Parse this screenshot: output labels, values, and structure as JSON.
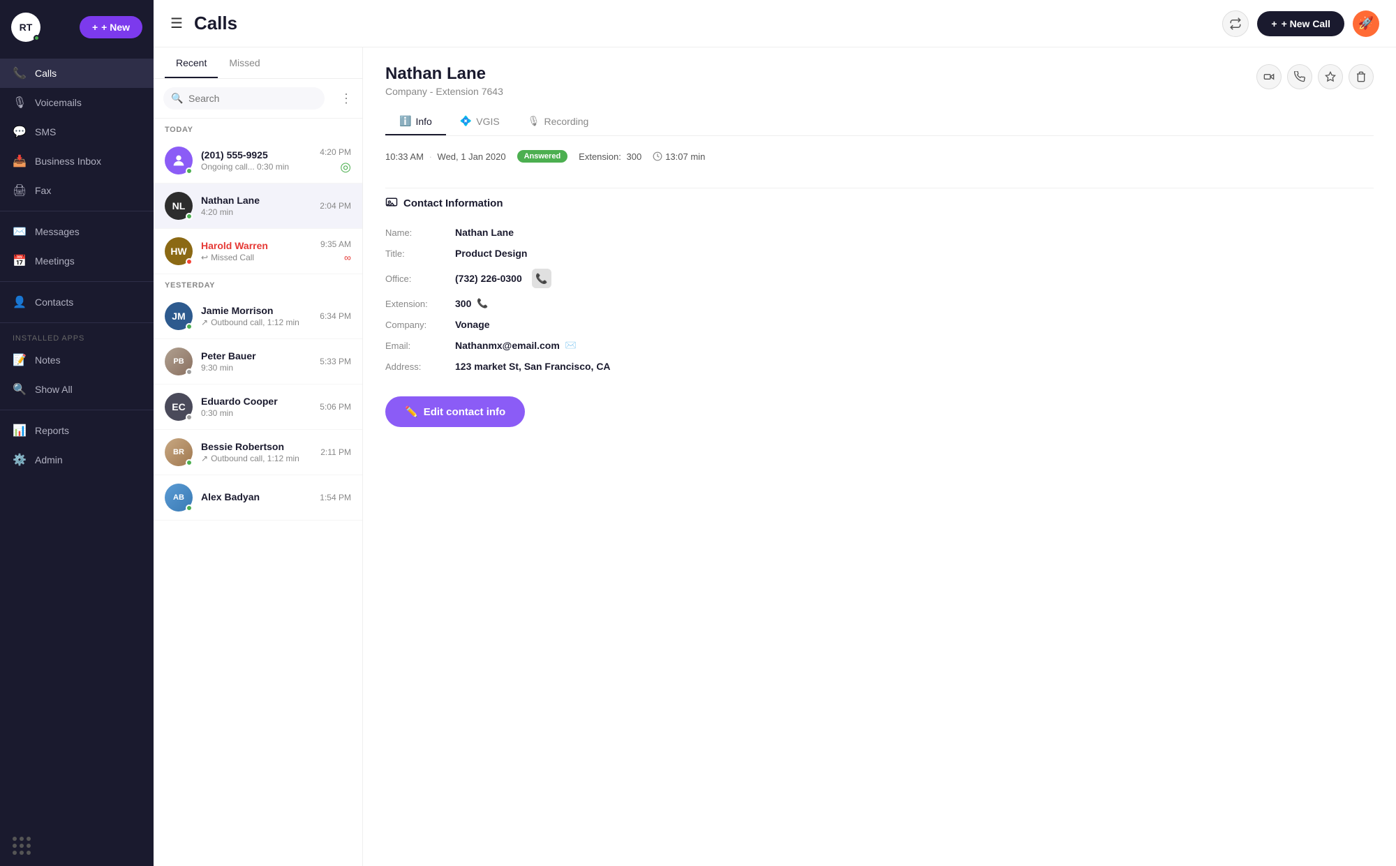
{
  "sidebar": {
    "avatar": "RT",
    "new_button": "+ New",
    "nav_items": [
      {
        "id": "calls",
        "label": "Calls",
        "icon": "📞",
        "active": true
      },
      {
        "id": "voicemails",
        "label": "Voicemails",
        "icon": "🎙️",
        "active": false
      },
      {
        "id": "sms",
        "label": "SMS",
        "icon": "💬",
        "active": false
      },
      {
        "id": "business-inbox",
        "label": "Business Inbox",
        "icon": "📥",
        "active": false
      },
      {
        "id": "fax",
        "label": "Fax",
        "icon": "🖨️",
        "active": false
      },
      {
        "id": "messages",
        "label": "Messages",
        "icon": "✉️",
        "active": false
      },
      {
        "id": "meetings",
        "label": "Meetings",
        "icon": "📅",
        "active": false
      },
      {
        "id": "contacts",
        "label": "Contacts",
        "icon": "👤",
        "active": false
      }
    ],
    "installed_apps_label": "INSTALLED APPS",
    "app_items": [
      {
        "id": "notes",
        "label": "Notes",
        "icon": "📝"
      },
      {
        "id": "show-all",
        "label": "Show All",
        "icon": "🔍"
      }
    ],
    "bottom_items": [
      {
        "id": "reports",
        "label": "Reports",
        "icon": "📊"
      },
      {
        "id": "admin",
        "label": "Admin",
        "icon": "⚙️"
      }
    ]
  },
  "topbar": {
    "page_title": "Calls",
    "new_call_label": "+ New Call"
  },
  "calls_panel": {
    "tabs": [
      {
        "id": "recent",
        "label": "Recent",
        "active": true
      },
      {
        "id": "missed",
        "label": "Missed",
        "active": false
      }
    ],
    "search_placeholder": "Search",
    "today_label": "TODAY",
    "yesterday_label": "YESTERDAY",
    "calls": [
      {
        "id": "call-1",
        "name": "(201) 555-9925",
        "sub": "Ongoing call... 0:30 min",
        "time": "4:20 PM",
        "initials": "?",
        "bg": "#8b5cf6",
        "color": "#fff",
        "status": "green",
        "is_live": true,
        "missed": false,
        "is_photo": false,
        "arrow": ""
      },
      {
        "id": "call-2",
        "name": "Nathan Lane",
        "sub": "4:20 min",
        "time": "2:04 PM",
        "initials": "NL",
        "bg": "#2d2d2d",
        "color": "#fff",
        "status": "green",
        "is_live": false,
        "missed": false,
        "active": true,
        "is_photo": false,
        "arrow": ""
      },
      {
        "id": "call-3",
        "name": "Harold Warren",
        "sub": "Missed Call",
        "time": "9:35 AM",
        "initials": "HW",
        "bg": "#8b4513",
        "color": "#fff",
        "status": "red",
        "is_live": false,
        "missed": true,
        "is_photo": false,
        "arrow": "↩"
      },
      {
        "id": "call-4",
        "name": "Jamie Morrison",
        "sub": "Outbound call, 1:12 min",
        "time": "6:34 PM",
        "initials": "JM",
        "bg": "#2d5a8e",
        "color": "#fff",
        "status": "green",
        "is_live": false,
        "missed": false,
        "is_photo": false,
        "arrow": "↗"
      },
      {
        "id": "call-5",
        "name": "Peter Bauer",
        "sub": "9:30 min",
        "time": "5:33 PM",
        "initials": "PB",
        "bg": "#ccc",
        "color": "#555",
        "status": "gray",
        "is_live": false,
        "missed": false,
        "is_photo": true,
        "photo_bg": "#b0a090",
        "arrow": ""
      },
      {
        "id": "call-6",
        "name": "Eduardo Cooper",
        "sub": "0:30 min",
        "time": "5:06 PM",
        "initials": "EC",
        "bg": "#444",
        "color": "#fff",
        "status": "gray",
        "is_live": false,
        "missed": false,
        "is_photo": false,
        "arrow": ""
      },
      {
        "id": "call-7",
        "name": "Bessie Robertson",
        "sub": "Outbound call, 1:12 min",
        "time": "2:11 PM",
        "initials": "BR",
        "bg": "#c8a882",
        "color": "#fff",
        "status": "green",
        "is_live": false,
        "missed": false,
        "is_photo": true,
        "photo_bg": "#c8a882",
        "arrow": "↗"
      },
      {
        "id": "call-8",
        "name": "Alex Badyan",
        "sub": "",
        "time": "1:54 PM",
        "initials": "AB",
        "bg": "#1abc9c",
        "color": "#fff",
        "status": "green",
        "is_live": false,
        "missed": false,
        "is_photo": true,
        "photo_bg": "#5a9bd4",
        "arrow": ""
      }
    ]
  },
  "detail": {
    "name": "Nathan Lane",
    "subtitle": "Company  -  Extension 7643",
    "tabs": [
      {
        "id": "info",
        "label": "Info",
        "icon": "ℹ️",
        "active": true
      },
      {
        "id": "vgis",
        "label": "VGIS",
        "icon": "💠",
        "active": false
      },
      {
        "id": "recording",
        "label": "Recording",
        "icon": "🎙️",
        "active": false
      }
    ],
    "call_time": "10:33 AM",
    "call_date": "Wed, 1 Jan 2020",
    "call_status": "Answered",
    "extension_label": "Extension:",
    "extension_val": "300",
    "duration_label": "13:07 min",
    "contact_section_label": "Contact Information",
    "contact_fields": [
      {
        "label": "Name:",
        "value": "Nathan Lane",
        "has_phone": false,
        "has_email": false
      },
      {
        "label": "Title:",
        "value": "Product  Design",
        "has_phone": false,
        "has_email": false
      },
      {
        "label": "Office:",
        "value": "(732) 226-0300",
        "has_phone": true,
        "has_email": false
      },
      {
        "label": "Extension:",
        "value": "300",
        "has_phone": true,
        "has_email": false,
        "ext": true
      },
      {
        "label": "Company:",
        "value": "Vonage",
        "has_phone": false,
        "has_email": false
      },
      {
        "label": "Email:",
        "value": "Nathanmx@email.com",
        "has_phone": false,
        "has_email": true
      },
      {
        "label": "Address:",
        "value": "123 market St, San Francisco, CA",
        "has_phone": false,
        "has_email": false
      }
    ],
    "edit_contact_label": "Edit contact info"
  }
}
